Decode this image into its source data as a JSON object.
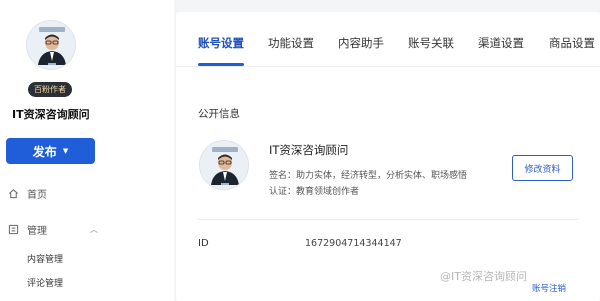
{
  "sidebar": {
    "role_badge": "百粉作者",
    "account_name": "IT资深咨询顾问",
    "publish_label": "发布",
    "nav": {
      "home_label": "首页",
      "manage_label": "管理",
      "sub_items": [
        "内容管理",
        "评论管理"
      ]
    }
  },
  "tabs": [
    "账号设置",
    "功能设置",
    "内容助手",
    "账号关联",
    "渠道设置",
    "商品设置"
  ],
  "active_tab": "账号设置",
  "public_info": {
    "section_title": "公开信息",
    "name": "IT资深咨询顾问",
    "signature": "签名：助力实体，经济转型，分析实体、职场感悟",
    "certification": "认证：教育领域创作者",
    "edit_button": "修改资料"
  },
  "id_row": {
    "label": "ID",
    "value": "1672904714344147"
  },
  "cancel_account": "账号注销",
  "watermark": "@IT资深咨询顾问",
  "colors": {
    "accent": "#1f5ed8",
    "badge_bg": "#2c2f36",
    "badge_text": "#f2d9a6"
  }
}
